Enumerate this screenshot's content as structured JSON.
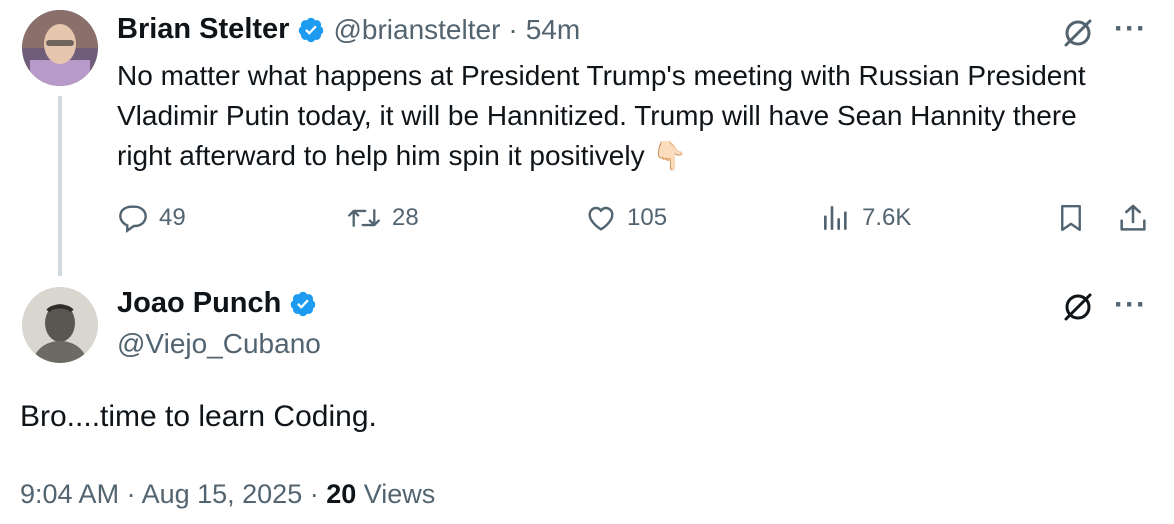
{
  "tweet1": {
    "author_name": "Brian Stelter",
    "handle": "@brianstelter",
    "separator": "·",
    "time": "54m",
    "verified": true,
    "text": "No matter what happens at President Trump's meeting with Russian President Vladimir Putin today, it will be Hannitized. Trump will have Sean Hannity there right afterward to help him spin it positively",
    "emoji": "👇🏻",
    "actions": {
      "replies": "49",
      "retweets": "28",
      "likes": "105",
      "views": "7.6K"
    }
  },
  "tweet2": {
    "author_name": "Joao Punch",
    "handle": "@Viejo_Cubano",
    "verified": true,
    "text": "Bro....time to learn Coding.",
    "timestamp": "9:04 AM · Aug 15, 2025 · ",
    "views_count": "20",
    "views_label": " Views"
  },
  "more_label": "···",
  "colors": {
    "verified": "#1d9bf0",
    "muted": "#536471",
    "text": "#0f1419",
    "thread_line": "#cfd9de"
  },
  "icons": {
    "grok": "grok-icon",
    "more": "more-icon",
    "reply": "reply-icon",
    "retweet": "retweet-icon",
    "like": "heart-icon",
    "views": "views-icon",
    "bookmark": "bookmark-icon",
    "share": "share-icon",
    "verified": "verified-badge-icon"
  }
}
